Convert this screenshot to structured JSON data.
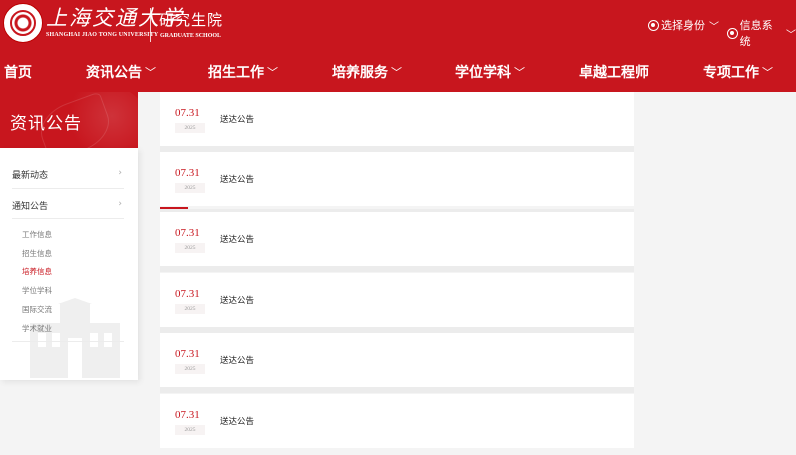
{
  "header": {
    "university_cn": "上海交通大学",
    "university_en": "SHANGHAI JIAO TONG UNIVERSITY",
    "school_cn": "研究生院",
    "school_en": "GRADUATE SCHOOL",
    "links": [
      {
        "label": "选择身份",
        "icon": "user-circle-icon"
      },
      {
        "label": "信息系统",
        "icon": "grid-circle-icon"
      }
    ]
  },
  "nav": [
    {
      "label": "首页",
      "has_dropdown": false
    },
    {
      "label": "资讯公告",
      "has_dropdown": true
    },
    {
      "label": "招生工作",
      "has_dropdown": true
    },
    {
      "label": "培养服务",
      "has_dropdown": true
    },
    {
      "label": "学位学科",
      "has_dropdown": true
    },
    {
      "label": "卓越工程师",
      "has_dropdown": false
    },
    {
      "label": "专项工作",
      "has_dropdown": true
    }
  ],
  "sidebar": {
    "title": "资讯公告",
    "categories": [
      {
        "label": "最新动态"
      },
      {
        "label": "通知公告"
      }
    ],
    "subitems": [
      {
        "label": "工作信息",
        "active": false
      },
      {
        "label": "招生信息",
        "active": false
      },
      {
        "label": "培养信息",
        "active": true
      },
      {
        "label": "学位学科",
        "active": false
      },
      {
        "label": "国际交流",
        "active": false
      },
      {
        "label": "学术就业",
        "active": false
      }
    ]
  },
  "news": [
    {
      "day": "07.31",
      "year": "2025",
      "title": "送达公告"
    },
    {
      "day": "07.31",
      "year": "2025",
      "title": "送达公告"
    },
    {
      "day": "07.31",
      "year": "2025",
      "title": "送达公告"
    },
    {
      "day": "07.31",
      "year": "2025",
      "title": "送达公告"
    },
    {
      "day": "07.31",
      "year": "2025",
      "title": "送达公告"
    },
    {
      "day": "07.31",
      "year": "2025",
      "title": "送达公告"
    }
  ],
  "colors": {
    "brand": "#c8161e",
    "background": "#f4f4f4"
  }
}
